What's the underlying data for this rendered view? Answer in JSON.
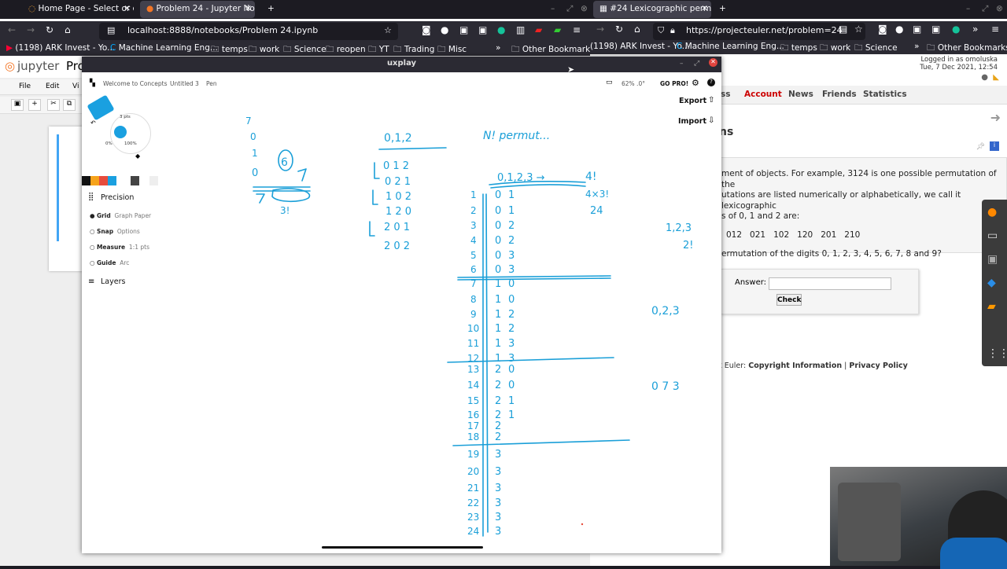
{
  "left_browser": {
    "tabs": [
      {
        "label": "Home Page - Select or cr"
      },
      {
        "label": "Problem 24 - Jupyter No"
      }
    ],
    "url": "localhost:8888/notebooks/Problem 24.ipynb",
    "bookmarks": [
      "(1198) ARK Invest - Yo...",
      "Machine Learning Eng...",
      "temps",
      "work",
      "Science",
      "reopen",
      "YT",
      "Trading",
      "Misc",
      "Other Bookmarks"
    ]
  },
  "jupyter": {
    "logo": "jupyter",
    "title": "Pro",
    "menu": [
      "File",
      "Edit",
      "Vi"
    ]
  },
  "right_browser": {
    "tab": "#24 Lexicographic permu",
    "url": "https://projecteuler.net/problem=24",
    "bookmarks": [
      "(1198) ARK Invest - Yo...",
      "Machine Learning Eng...",
      "temps",
      "work",
      "Science",
      "Other Bookmarks"
    ],
    "logged_in": "Logged in as omoluska",
    "date": "Tue, 7 Dec 2021, 12:54",
    "nav": [
      "ss",
      "Account",
      "News",
      "Friends",
      "Statistics"
    ],
    "heading": "ns",
    "para1_l1": "ment of objects. For example, 3124 is one possible permutation of the",
    "para1_l2": "utations are listed numerically or alphabetically, we call it lexicographic",
    "para1_l3": "s of 0, 1 and 2 are:",
    "perms": "012   021   102   120   201   210",
    "para2": "ermutation of the digits 0, 1, 2, 3, 4, 5, 6, 7, 8 and 9?",
    "answer_label": "Answer:",
    "answer_value": "",
    "check": "Check",
    "footer_prefix": "t Euler: ",
    "footer_link1": "Copyright Information",
    "footer_sep": " | ",
    "footer_link2": "Privacy Policy"
  },
  "concepts": {
    "window_title": "uxplay",
    "tabs": [
      "Welcome to Concepts",
      "Untitled 3",
      "Pen"
    ],
    "zoom": "62%  .0°",
    "gopro": "GO PRO!",
    "export": "Export",
    "import": "Import",
    "brush_size": "3 pts",
    "brush_opacity": "100%",
    "brush_smooth": "0%",
    "precision": "Precision",
    "options": [
      {
        "label": "Grid",
        "value": "Graph Paper"
      },
      {
        "label": "Snap",
        "value": "Options"
      },
      {
        "label": "Measure",
        "value": "1:1 pts"
      },
      {
        "label": "Guide",
        "value": "Arc"
      }
    ],
    "layers": "Layers"
  },
  "handwriting": {
    "set_012": "0,1,2",
    "n_perm": "N! permut...",
    "set_0123": "0,1,2,3 →",
    "fact4": "4!",
    "fact_expr": "4×3!",
    "fact_val": "24",
    "set_123": "1,2,3",
    "fact2": "2!",
    "set_023": "0,2,3",
    "set_073": "0 7 3",
    "perms_012": [
      "0 1 2",
      "0 2 1",
      "1 0 2",
      "1 2 0",
      "2 0 1",
      "2 0 2"
    ],
    "left_col": [
      "7",
      "0",
      "1",
      "0"
    ],
    "left_six": "6",
    "left_expr": "3!",
    "row_numbers": [
      "1",
      "2",
      "3",
      "4",
      "5",
      "6",
      "7",
      "8",
      "9",
      "10",
      "11",
      "12",
      "13",
      "14",
      "15",
      "16",
      "17",
      "18",
      "19",
      "20",
      "21",
      "22",
      "23",
      "24"
    ],
    "first_digits": [
      "0",
      "0",
      "0",
      "0",
      "0",
      "0",
      "1",
      "1",
      "1",
      "1",
      "1",
      "1",
      "2",
      "2",
      "2",
      "2",
      "2",
      "2",
      "3",
      "3",
      "3",
      "3",
      "3",
      "3"
    ],
    "second_digits": [
      "1",
      "1",
      "2",
      "2",
      "3",
      "3",
      "0",
      "0",
      "2",
      "2",
      "3",
      "3",
      "0",
      "0",
      "1",
      "1",
      "",
      "",
      "",
      "",
      "",
      "",
      "",
      ""
    ]
  }
}
